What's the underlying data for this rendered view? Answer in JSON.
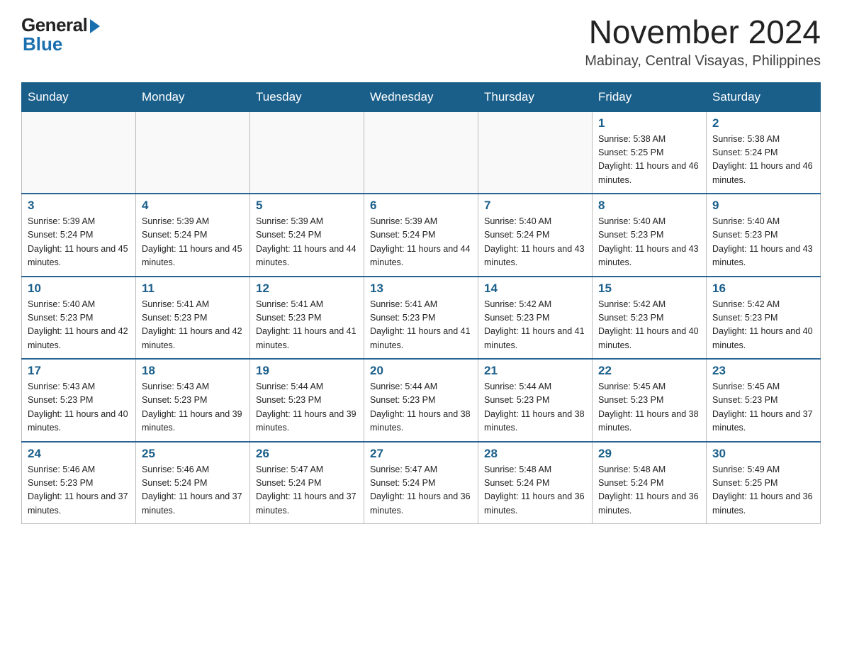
{
  "header": {
    "logo_general": "General",
    "logo_blue": "Blue",
    "month_year": "November 2024",
    "location": "Mabinay, Central Visayas, Philippines"
  },
  "weekdays": [
    "Sunday",
    "Monday",
    "Tuesday",
    "Wednesday",
    "Thursday",
    "Friday",
    "Saturday"
  ],
  "weeks": [
    [
      {
        "day": "",
        "info": ""
      },
      {
        "day": "",
        "info": ""
      },
      {
        "day": "",
        "info": ""
      },
      {
        "day": "",
        "info": ""
      },
      {
        "day": "",
        "info": ""
      },
      {
        "day": "1",
        "info": "Sunrise: 5:38 AM\nSunset: 5:25 PM\nDaylight: 11 hours and 46 minutes."
      },
      {
        "day": "2",
        "info": "Sunrise: 5:38 AM\nSunset: 5:24 PM\nDaylight: 11 hours and 46 minutes."
      }
    ],
    [
      {
        "day": "3",
        "info": "Sunrise: 5:39 AM\nSunset: 5:24 PM\nDaylight: 11 hours and 45 minutes."
      },
      {
        "day": "4",
        "info": "Sunrise: 5:39 AM\nSunset: 5:24 PM\nDaylight: 11 hours and 45 minutes."
      },
      {
        "day": "5",
        "info": "Sunrise: 5:39 AM\nSunset: 5:24 PM\nDaylight: 11 hours and 44 minutes."
      },
      {
        "day": "6",
        "info": "Sunrise: 5:39 AM\nSunset: 5:24 PM\nDaylight: 11 hours and 44 minutes."
      },
      {
        "day": "7",
        "info": "Sunrise: 5:40 AM\nSunset: 5:24 PM\nDaylight: 11 hours and 43 minutes."
      },
      {
        "day": "8",
        "info": "Sunrise: 5:40 AM\nSunset: 5:23 PM\nDaylight: 11 hours and 43 minutes."
      },
      {
        "day": "9",
        "info": "Sunrise: 5:40 AM\nSunset: 5:23 PM\nDaylight: 11 hours and 43 minutes."
      }
    ],
    [
      {
        "day": "10",
        "info": "Sunrise: 5:40 AM\nSunset: 5:23 PM\nDaylight: 11 hours and 42 minutes."
      },
      {
        "day": "11",
        "info": "Sunrise: 5:41 AM\nSunset: 5:23 PM\nDaylight: 11 hours and 42 minutes."
      },
      {
        "day": "12",
        "info": "Sunrise: 5:41 AM\nSunset: 5:23 PM\nDaylight: 11 hours and 41 minutes."
      },
      {
        "day": "13",
        "info": "Sunrise: 5:41 AM\nSunset: 5:23 PM\nDaylight: 11 hours and 41 minutes."
      },
      {
        "day": "14",
        "info": "Sunrise: 5:42 AM\nSunset: 5:23 PM\nDaylight: 11 hours and 41 minutes."
      },
      {
        "day": "15",
        "info": "Sunrise: 5:42 AM\nSunset: 5:23 PM\nDaylight: 11 hours and 40 minutes."
      },
      {
        "day": "16",
        "info": "Sunrise: 5:42 AM\nSunset: 5:23 PM\nDaylight: 11 hours and 40 minutes."
      }
    ],
    [
      {
        "day": "17",
        "info": "Sunrise: 5:43 AM\nSunset: 5:23 PM\nDaylight: 11 hours and 40 minutes."
      },
      {
        "day": "18",
        "info": "Sunrise: 5:43 AM\nSunset: 5:23 PM\nDaylight: 11 hours and 39 minutes."
      },
      {
        "day": "19",
        "info": "Sunrise: 5:44 AM\nSunset: 5:23 PM\nDaylight: 11 hours and 39 minutes."
      },
      {
        "day": "20",
        "info": "Sunrise: 5:44 AM\nSunset: 5:23 PM\nDaylight: 11 hours and 38 minutes."
      },
      {
        "day": "21",
        "info": "Sunrise: 5:44 AM\nSunset: 5:23 PM\nDaylight: 11 hours and 38 minutes."
      },
      {
        "day": "22",
        "info": "Sunrise: 5:45 AM\nSunset: 5:23 PM\nDaylight: 11 hours and 38 minutes."
      },
      {
        "day": "23",
        "info": "Sunrise: 5:45 AM\nSunset: 5:23 PM\nDaylight: 11 hours and 37 minutes."
      }
    ],
    [
      {
        "day": "24",
        "info": "Sunrise: 5:46 AM\nSunset: 5:23 PM\nDaylight: 11 hours and 37 minutes."
      },
      {
        "day": "25",
        "info": "Sunrise: 5:46 AM\nSunset: 5:24 PM\nDaylight: 11 hours and 37 minutes."
      },
      {
        "day": "26",
        "info": "Sunrise: 5:47 AM\nSunset: 5:24 PM\nDaylight: 11 hours and 37 minutes."
      },
      {
        "day": "27",
        "info": "Sunrise: 5:47 AM\nSunset: 5:24 PM\nDaylight: 11 hours and 36 minutes."
      },
      {
        "day": "28",
        "info": "Sunrise: 5:48 AM\nSunset: 5:24 PM\nDaylight: 11 hours and 36 minutes."
      },
      {
        "day": "29",
        "info": "Sunrise: 5:48 AM\nSunset: 5:24 PM\nDaylight: 11 hours and 36 minutes."
      },
      {
        "day": "30",
        "info": "Sunrise: 5:49 AM\nSunset: 5:25 PM\nDaylight: 11 hours and 36 minutes."
      }
    ]
  ]
}
